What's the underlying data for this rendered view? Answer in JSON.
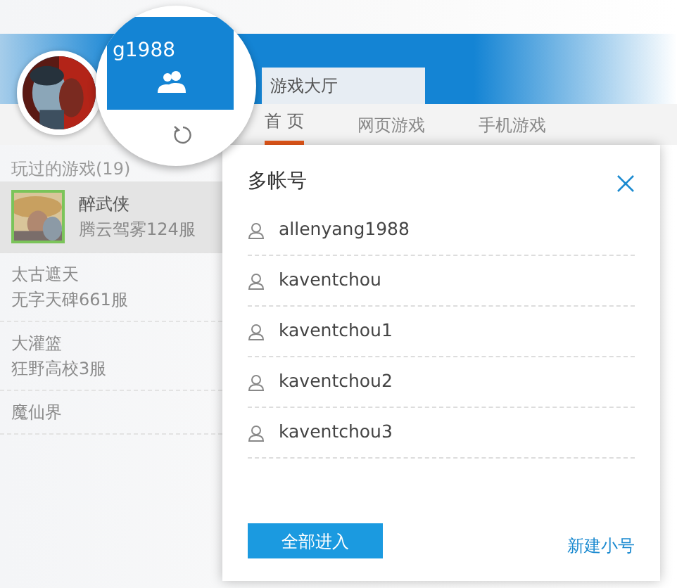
{
  "magnifier": {
    "username": "g1988"
  },
  "hall": {
    "title": "游戏大厅",
    "tabs": [
      {
        "label": "首 页",
        "selected": true
      },
      {
        "label": "网页游戏",
        "selected": false
      },
      {
        "label": "手机游戏",
        "selected": false
      }
    ]
  },
  "played": {
    "heading": "玩过的游戏(19)",
    "games": [
      {
        "name": "醉武侠",
        "server": "腾云驾雾124服",
        "selected": true
      },
      {
        "name": "太古遮天",
        "server": "无字天碑661服",
        "selected": false
      },
      {
        "name": "大灌篮",
        "server": "狂野高校3服",
        "selected": false
      },
      {
        "name": "魔仙界",
        "selected": false
      }
    ]
  },
  "accounts_popup": {
    "title": "多帐号",
    "accounts": [
      "allenyang1988",
      "kaventchou",
      "kaventchou1",
      "kaventchou2",
      "kaventchou3"
    ],
    "enter_all_button": "全部进入",
    "new_account_link": "新建小号"
  }
}
